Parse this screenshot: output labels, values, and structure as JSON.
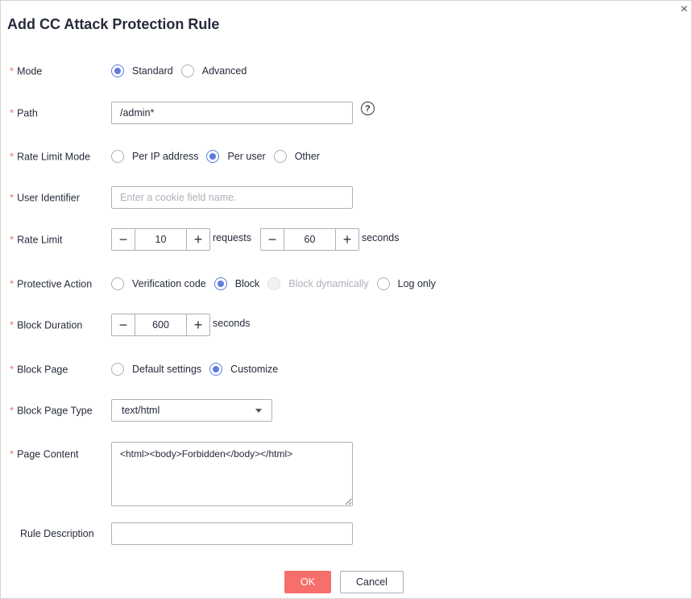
{
  "dialog": {
    "title": "Add CC Attack Protection Rule",
    "close_icon": "×",
    "ok": "OK",
    "cancel": "Cancel"
  },
  "colors": {
    "primary": "#5e7ce0",
    "danger": "#f66f6a"
  },
  "fields": {
    "mode": {
      "label": "Mode",
      "options": [
        "Standard",
        "Advanced"
      ],
      "selected": "Standard"
    },
    "path": {
      "label": "Path",
      "value": "/admin*",
      "help_icon": "?"
    },
    "rate_limit_mode": {
      "label": "Rate Limit Mode",
      "options": [
        "Per IP address",
        "Per user",
        "Other"
      ],
      "selected": "Per user"
    },
    "user_identifier": {
      "label": "User Identifier",
      "value": "",
      "placeholder": "Enter a cookie field name."
    },
    "rate_limit": {
      "label": "Rate Limit",
      "requests": "10",
      "requests_unit": "requests",
      "seconds": "60",
      "seconds_unit": "seconds"
    },
    "protective_action": {
      "label": "Protective Action",
      "options": [
        "Verification code",
        "Block",
        "Block dynamically",
        "Log only"
      ],
      "selected": "Block",
      "disabled": "Block dynamically"
    },
    "block_duration": {
      "label": "Block Duration",
      "value": "600",
      "unit": "seconds"
    },
    "block_page": {
      "label": "Block Page",
      "options": [
        "Default settings",
        "Customize"
      ],
      "selected": "Customize"
    },
    "block_page_type": {
      "label": "Block Page Type",
      "value": "text/html"
    },
    "page_content": {
      "label": "Page Content",
      "value": "<html><body>Forbidden</body></html>"
    },
    "rule_description": {
      "label": "Rule Description",
      "value": ""
    }
  },
  "stepper": {
    "minus": "−",
    "plus": "+"
  }
}
